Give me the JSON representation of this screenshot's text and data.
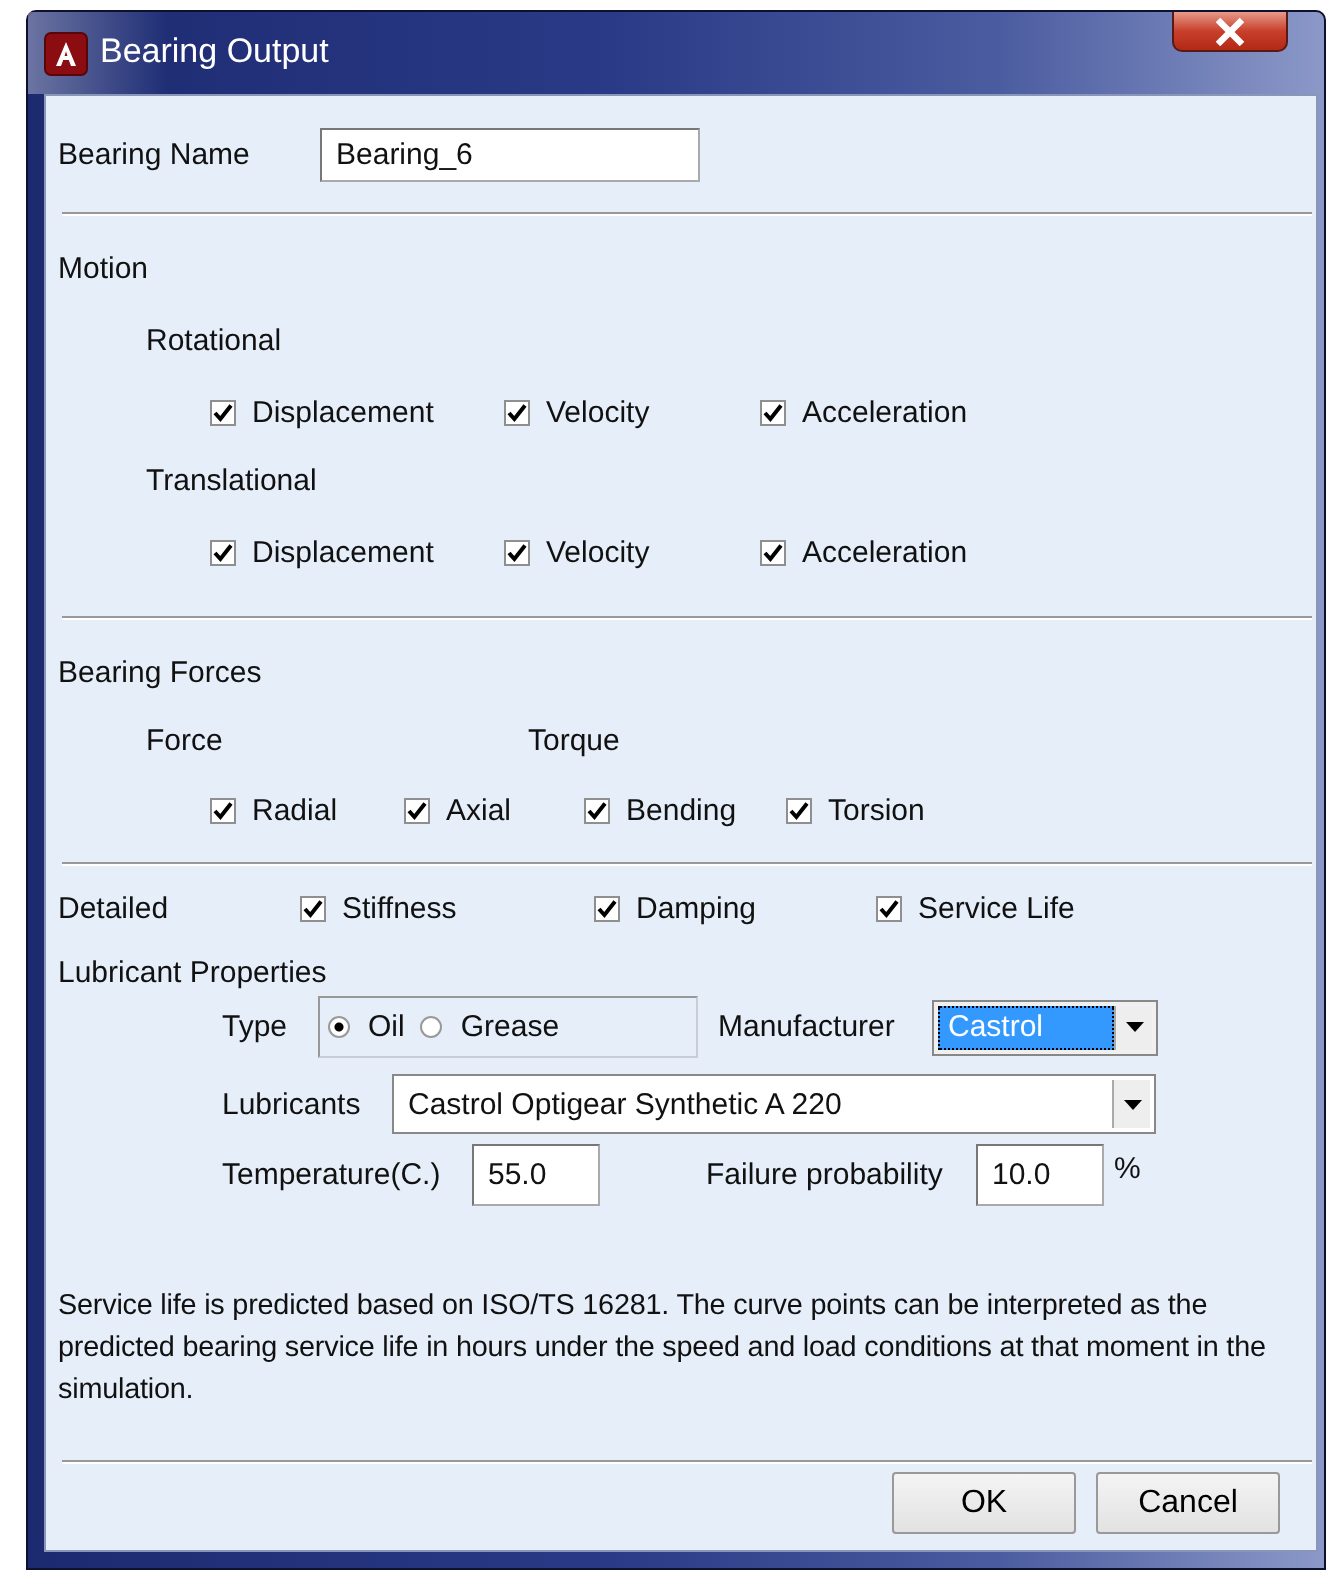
{
  "window": {
    "title": "Bearing Output"
  },
  "bearing_name": {
    "label": "Bearing Name",
    "value": "Bearing_6"
  },
  "motion": {
    "title": "Motion",
    "groups": [
      {
        "title": "Rotational",
        "options": [
          {
            "label": "Displacement",
            "checked": true
          },
          {
            "label": "Velocity",
            "checked": true
          },
          {
            "label": "Acceleration",
            "checked": true
          }
        ]
      },
      {
        "title": "Translational",
        "options": [
          {
            "label": "Displacement",
            "checked": true
          },
          {
            "label": "Velocity",
            "checked": true
          },
          {
            "label": "Acceleration",
            "checked": true
          }
        ]
      }
    ]
  },
  "bearing_forces": {
    "title": "Bearing Forces",
    "groups": [
      {
        "title": "Force",
        "options": [
          {
            "label": "Radial",
            "checked": true
          },
          {
            "label": "Axial",
            "checked": true
          }
        ]
      },
      {
        "title": "Torque",
        "options": [
          {
            "label": "Bending",
            "checked": true
          },
          {
            "label": "Torsion",
            "checked": true
          }
        ]
      }
    ]
  },
  "detailed": {
    "label": "Detailed",
    "options": [
      {
        "label": "Stiffness",
        "checked": true
      },
      {
        "label": "Damping",
        "checked": true
      },
      {
        "label": "Service Life",
        "checked": true
      }
    ]
  },
  "lubricant": {
    "title": "Lubricant Properties",
    "type": {
      "label": "Type",
      "options": [
        {
          "label": "Oil",
          "selected": true
        },
        {
          "label": "Grease",
          "selected": false
        }
      ]
    },
    "manufacturer": {
      "label": "Manufacturer",
      "value": "Castrol"
    },
    "lubricants": {
      "label": "Lubricants",
      "value": "Castrol Optigear Synthetic A 220"
    },
    "temperature": {
      "label": "Temperature(C.)",
      "value": "55.0"
    },
    "failure_probability": {
      "label": "Failure probability",
      "value": "10.0",
      "unit": "%"
    }
  },
  "note": "Service life is predicted based on ISO/TS 16281. The curve points can be interpreted as the predicted bearing service life in hours under the speed and load conditions at that moment in the simulation.",
  "buttons": [
    "OK",
    "Cancel"
  ]
}
